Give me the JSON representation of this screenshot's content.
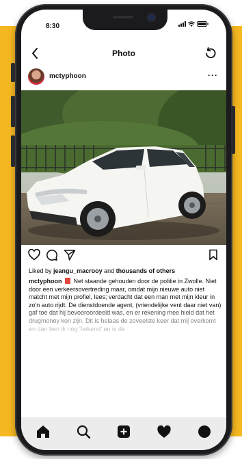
{
  "status_bar": {
    "time": "8:30"
  },
  "nav": {
    "title": "Photo"
  },
  "post": {
    "username": "mctyphoon",
    "more": "···",
    "likes": {
      "prefix": "Liked by",
      "user": "jeangu_macrooy",
      "and": "and",
      "others": "thousands of others"
    },
    "caption": {
      "username": "mctyphoon",
      "text": "Net staande gehouden door de politie in Zwolle. Niet door een verkeersovertreding maar, omdat mijn nieuwe auto niet matcht met mijn profiel, lees; verdacht dat een man met mijn kleur in zo'n auto rijdt. De dienstdoende agent, (vriendelijke vent daar niet van) gaf toe dat hij bevooroordeeld was, en er rekening mee hield dat het drugmoney kon zijn. Dit is helaas de zoveelste keer dat mij overkomt en dan ben ik nog 'bekend' en is de"
    }
  },
  "tabs": [
    "home-tab",
    "search-tab",
    "create-tab",
    "activity-tab",
    "profile-tab"
  ],
  "colors": {
    "background_accent": "#f6b821",
    "phone_frame": "#1b1b1e",
    "tab_bar": "#ececec",
    "text": "#111111"
  }
}
